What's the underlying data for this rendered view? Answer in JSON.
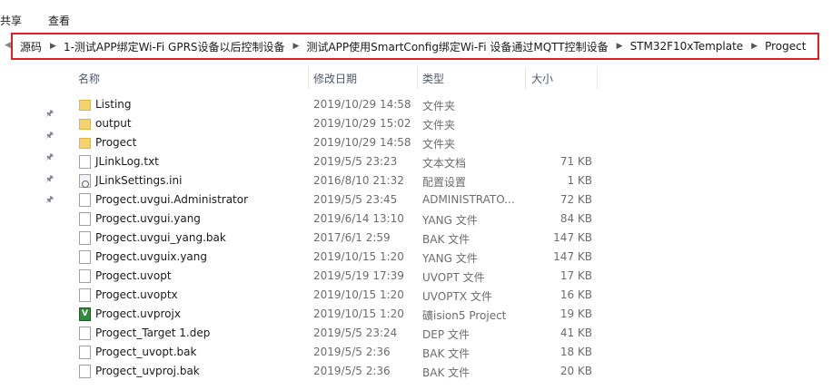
{
  "menu": {
    "share": "共享",
    "view": "查看"
  },
  "breadcrumb": [
    "源码",
    "1-测试APP绑定Wi-Fi  GPRS设备以后控制设备",
    "测试APP使用SmartConfig绑定Wi-Fi 设备通过MQTT控制设备",
    "STM32F10xTemplate",
    "Progect"
  ],
  "columns": {
    "name": "名称",
    "date": "修改日期",
    "type": "类型",
    "size": "大小"
  },
  "files": [
    {
      "name": "Listing",
      "date": "2019/10/29 14:58",
      "type": "文件夹",
      "size": "",
      "icon": "folder-icon"
    },
    {
      "name": "output",
      "date": "2019/10/29 15:02",
      "type": "文件夹",
      "size": "",
      "icon": "folder-icon"
    },
    {
      "name": "Progect",
      "date": "2019/10/29 14:58",
      "type": "文件夹",
      "size": "",
      "icon": "folder-icon"
    },
    {
      "name": "JLinkLog.txt",
      "date": "2019/5/5 23:23",
      "type": "文本文档",
      "size": "71 KB",
      "icon": "text-file-icon"
    },
    {
      "name": "JLinkSettings.ini",
      "date": "2016/8/10 21:32",
      "type": "配置设置",
      "size": "1 KB",
      "icon": "settings-file-icon"
    },
    {
      "name": "Progect.uvgui.Administrator",
      "date": "2019/5/5 23:45",
      "type": "ADMINISTRATO...",
      "size": "72 KB",
      "icon": "file-icon"
    },
    {
      "name": "Progect.uvgui.yang",
      "date": "2019/6/14 13:10",
      "type": "YANG 文件",
      "size": "84 KB",
      "icon": "file-icon"
    },
    {
      "name": "Progect.uvgui_yang.bak",
      "date": "2017/6/1 2:59",
      "type": "BAK 文件",
      "size": "147 KB",
      "icon": "file-icon"
    },
    {
      "name": "Progect.uvguix.yang",
      "date": "2019/10/15 1:20",
      "type": "YANG 文件",
      "size": "147 KB",
      "icon": "file-icon"
    },
    {
      "name": "Progect.uvopt",
      "date": "2019/5/19 17:39",
      "type": "UVOPT 文件",
      "size": "17 KB",
      "icon": "file-icon"
    },
    {
      "name": "Progect.uvoptx",
      "date": "2019/10/15 1:20",
      "type": "UVOPTX 文件",
      "size": "16 KB",
      "icon": "file-icon"
    },
    {
      "name": "Progect.uvprojx",
      "date": "2019/10/15 1:20",
      "type": "礦ision5 Project",
      "size": "19 KB",
      "icon": "uvision-project-icon"
    },
    {
      "name": "Progect_Target 1.dep",
      "date": "2019/5/5 23:24",
      "type": "DEP 文件",
      "size": "41 KB",
      "icon": "file-icon"
    },
    {
      "name": "Progect_uvopt.bak",
      "date": "2019/5/5 2:36",
      "type": "BAK 文件",
      "size": "18 KB",
      "icon": "file-icon"
    },
    {
      "name": "Progect_uvproj.bak",
      "date": "2019/5/5 2:36",
      "type": "BAK 文件",
      "size": "20 KB",
      "icon": "file-icon"
    }
  ],
  "icons": {
    "back": "chevron-left-icon",
    "separator": "chevron-right-icon",
    "pin": "pin-icon",
    "uvision_letter": "V"
  },
  "colors": {
    "highlight_border": "#e02020",
    "folder": "#f5d36b"
  }
}
